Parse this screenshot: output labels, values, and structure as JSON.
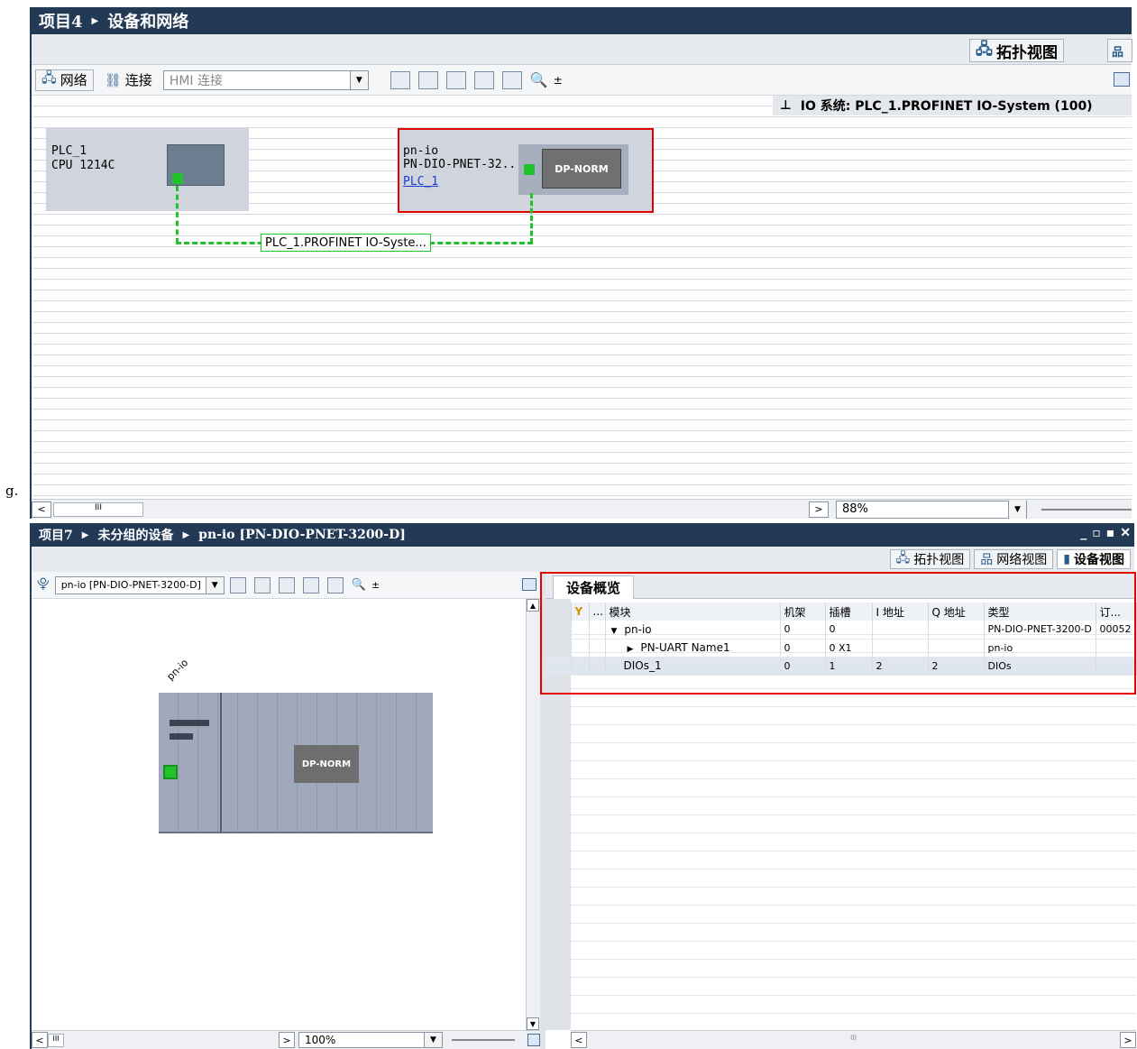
{
  "top": {
    "breadcrumb": [
      "项目4",
      "设备和网络"
    ],
    "view_topology": "拓扑视图",
    "toolbar": {
      "network": "网络",
      "connections": "连接",
      "hmi_placeholder": "HMI 连接"
    },
    "io_system": "IO 系统: PLC_1.PROFINET IO-System (100)",
    "plc": {
      "name": "PLC_1",
      "cpu": "CPU 1214C"
    },
    "pnio": {
      "name": "pn-io",
      "type": "PN-DIO-PNET-32...",
      "link": "PLC_1",
      "module": "DP-NORM"
    },
    "profinet_label": "PLC_1.PROFINET IO-Syste...",
    "zoom": "88%"
  },
  "side_text": "g.",
  "bottom": {
    "breadcrumb": [
      "项目7",
      "未分组的设备",
      "pn-io [PN-DIO-PNET-3200-D]"
    ],
    "window_controls": [
      "_",
      "▫",
      "▪",
      "✕"
    ],
    "views": [
      "拓扑视图",
      "网络视图",
      "设备视图"
    ],
    "device_select": "pn-io [PN-DIO-PNET-3200-D]",
    "device_label": "pn-io",
    "module_label": "DP-NORM",
    "zoom": "100%",
    "overview_tab": "设备概览",
    "columns": [
      "",
      "...",
      "模块",
      "机架",
      "插槽",
      "I 地址",
      "Q 地址",
      "类型",
      "订..."
    ],
    "rows": [
      {
        "module": "pn-io",
        "rack": "0",
        "slot": "0",
        "i": "",
        "q": "",
        "type": "PN-DIO-PNET-3200-D",
        "order": "00052",
        "level": 0,
        "expander": "▼"
      },
      {
        "module": "PN-UART Name1",
        "rack": "0",
        "slot": "0 X1",
        "i": "",
        "q": "",
        "type": "pn-io",
        "order": "",
        "level": 1,
        "expander": "▶"
      },
      {
        "module": "DIOs_1",
        "rack": "0",
        "slot": "1",
        "i": "2",
        "q": "2",
        "type": "DIOs",
        "order": "",
        "level": 0,
        "expander": ""
      }
    ],
    "hscroll": "III"
  },
  "colors": {
    "titlebar": "#233a56",
    "highlight": "#e60000",
    "profinet": "#22c32a"
  }
}
